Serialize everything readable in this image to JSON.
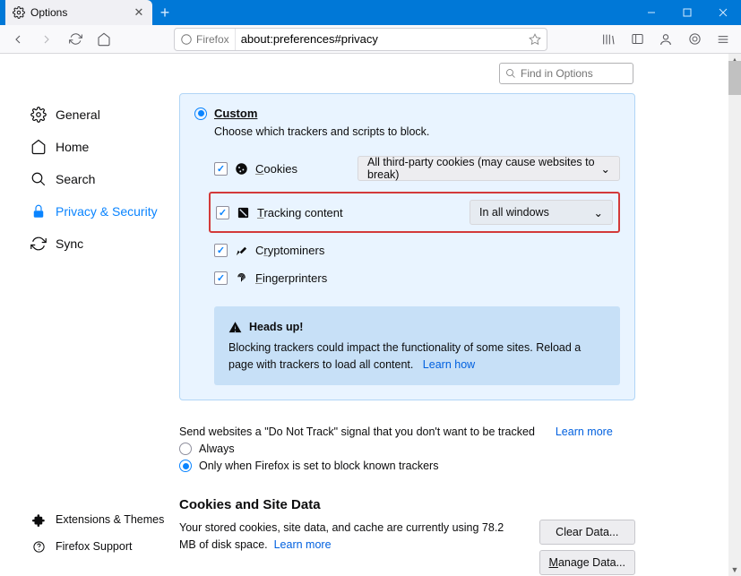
{
  "tab": {
    "title": "Options"
  },
  "url": {
    "identity": "Firefox",
    "value": "about:preferences#privacy"
  },
  "search": {
    "placeholder": "Find in Options"
  },
  "nav": {
    "general": "General",
    "home": "Home",
    "search": "Search",
    "privacy": "Privacy & Security",
    "sync": "Sync",
    "ext": "Extensions & Themes",
    "support": "Firefox Support"
  },
  "custom": {
    "title": "Custom",
    "desc": "Choose which trackers and scripts to block.",
    "cookies": "Cookies",
    "cookies_select": "All third-party cookies (may cause websites to break)",
    "tracking": "Tracking content",
    "tracking_select": "In all windows",
    "crypto": "Cryptominers",
    "finger": "Fingerprinters",
    "warn_title": "Heads up!",
    "warn_body": "Blocking trackers could impact the functionality of some sites. Reload a page with trackers to load all content.",
    "warn_link": "Learn how"
  },
  "dnt": {
    "text1": "Send websites a \"Do Not Track\" signal that you don't want to be tracked",
    "learn": "Learn more",
    "always": "Always",
    "only": "Only when Firefox is set to block known trackers"
  },
  "csd": {
    "title": "Cookies and Site Data",
    "body": "Your stored cookies, site data, and cache are currently using 78.2 MB of disk space.",
    "learn": "Learn more",
    "clear": "Clear Data...",
    "manage": "Manage Data..."
  }
}
